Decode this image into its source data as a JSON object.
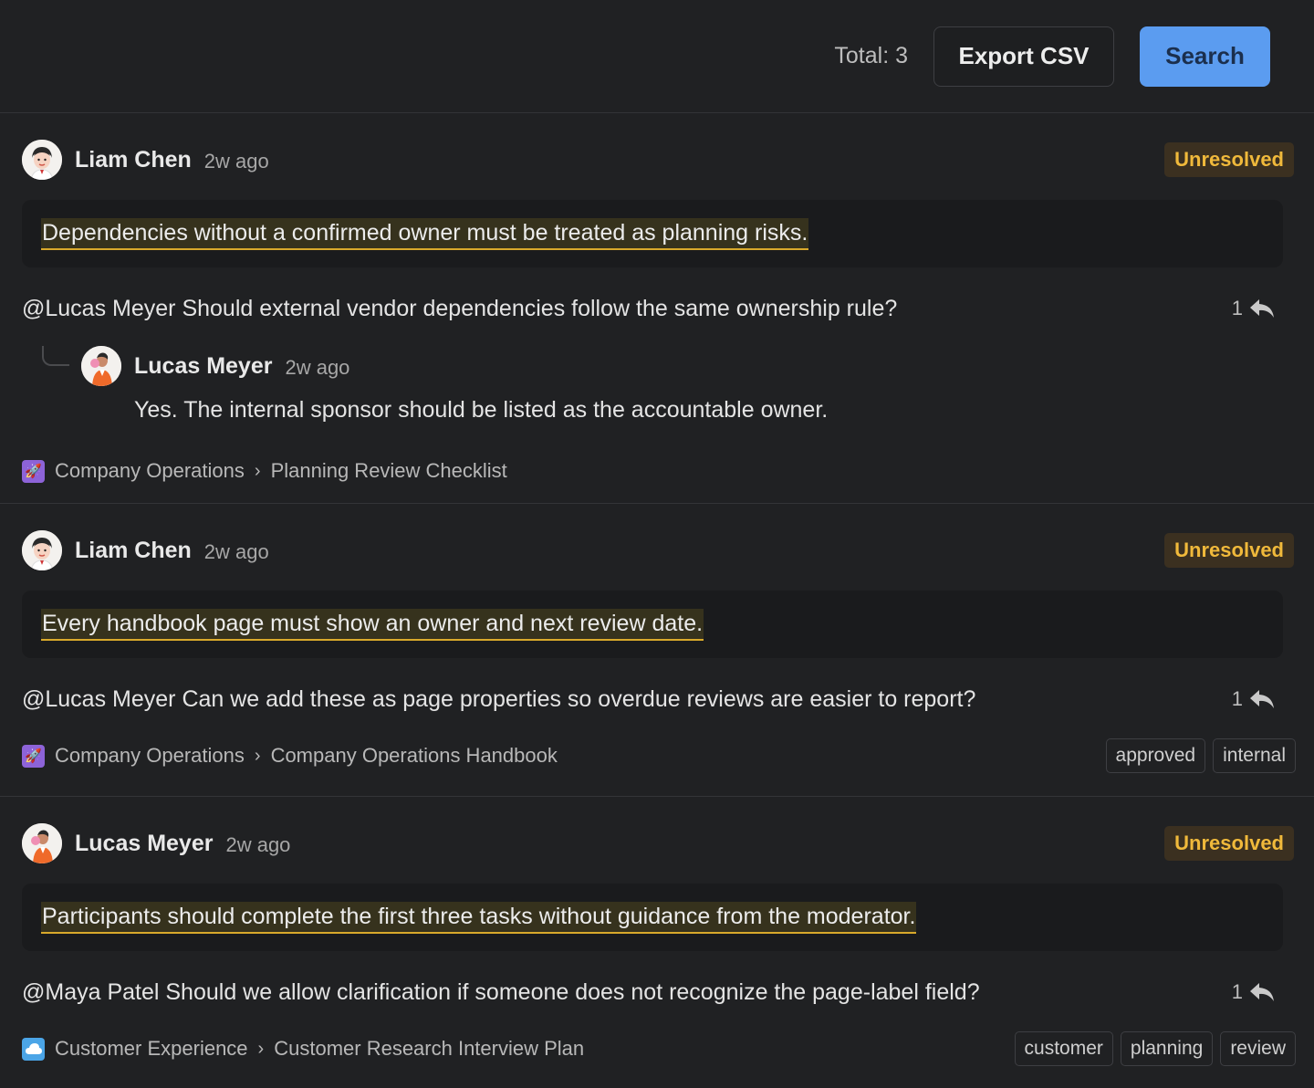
{
  "toolbar": {
    "total_label": "Total: 3",
    "export_label": "Export CSV",
    "search_label": "Search"
  },
  "threads": [
    {
      "author": "Liam Chen",
      "time": "2w ago",
      "status": "Unresolved",
      "quote": "Dependencies without a confirmed owner must be treated as planning risks.",
      "comment": "@Lucas Meyer Should external vendor dependencies follow the same ownership rule?",
      "reply_count": "1",
      "reply": {
        "author": "Lucas Meyer",
        "time": "2w ago",
        "text": "Yes. The internal sponsor should be listed as the accountable owner."
      },
      "space": "Company Operations",
      "page": "Planning Review Checklist",
      "labels": []
    },
    {
      "author": "Liam Chen",
      "time": "2w ago",
      "status": "Unresolved",
      "quote": "Every handbook page must show an owner and next review date.",
      "comment": "@Lucas Meyer Can we add these as page properties so overdue reviews are easier to report?",
      "reply_count": "1",
      "space": "Company Operations",
      "page": "Company Operations Handbook",
      "labels": [
        "approved",
        "internal"
      ]
    },
    {
      "author": "Lucas Meyer",
      "time": "2w ago",
      "status": "Unresolved",
      "quote": "Participants should complete the first three tasks without guidance from the moderator.",
      "comment": "@Maya Patel Should we allow clarification if someone does not recognize the page-label field?",
      "reply_count": "1",
      "space": "Customer Experience",
      "page": "Customer Research Interview Plan",
      "labels": [
        "customer",
        "planning",
        "review"
      ]
    }
  ],
  "breadcrumb_separator": "›",
  "colors": {
    "background": "#202123",
    "accent": "#5b9cf0",
    "status_unresolved": "#f0b93b",
    "highlight_underline": "#d9a92b"
  },
  "icons": {
    "reply": "reply-arrow-icon",
    "space_ops": "rocket-icon",
    "space_cx": "cloud-icon"
  }
}
